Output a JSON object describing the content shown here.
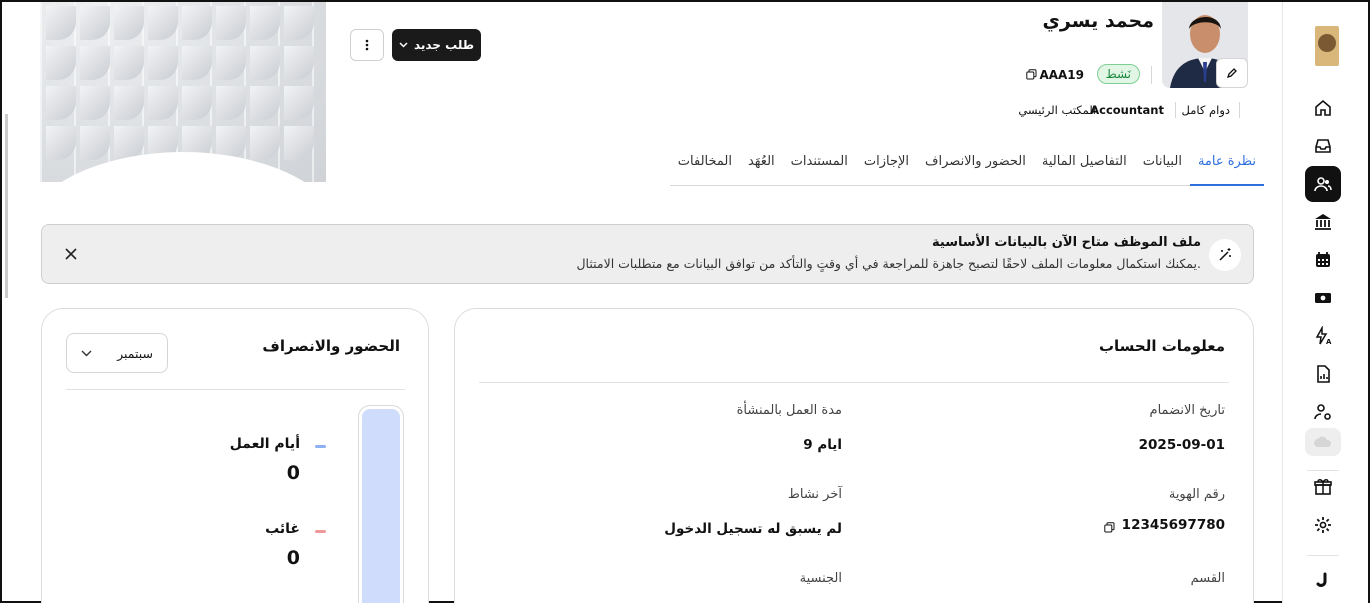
{
  "employee": {
    "name": "محمد يسري",
    "status": "نَشط",
    "code": "AAA19",
    "employment_type": "دوام كامل",
    "job_title": "Accountant",
    "branch": "المكتب الرئيسي"
  },
  "actions": {
    "new_request": "طلب جديد"
  },
  "tabs": [
    "نظرة عامة",
    "البيانات",
    "التفاصيل المالية",
    "الحضور والانصراف",
    "الإجازات",
    "المستندات",
    "العُهَد",
    "المخالفات"
  ],
  "alert": {
    "title": "ملف الموظف متاح الآن بالبيانات الأساسية",
    "body": "يمكنك استكمال معلومات الملف لاحقًا لتصبح جاهزة للمراجعة في أي وقتٍ والتأكد من توافق البيانات مع متطلبات الامتثال."
  },
  "account": {
    "title": "معلومات الحساب",
    "join_date_label": "تاريخ الانضمام",
    "join_date": "2025-09-01",
    "tenure_label": "مدة العمل بالمنشأة",
    "tenure": "9 ايام",
    "id_label": "رقم الهوية",
    "id_number": "12345697780",
    "last_activity_label": "آخر نشاط",
    "last_activity": "لم يسبق له تسجيل الدخول",
    "department_label": "القسم",
    "nationality_label": "الجنسية"
  },
  "attendance": {
    "title": "الحضور والانصراف",
    "month": "سبتمبر",
    "work_days_label": "أيام العمل",
    "work_days": "0",
    "absent_label": "غائب",
    "absent": "0",
    "colors": {
      "work": "#8fb0f3",
      "absent": "#ef9a9a",
      "bar": "#cfdcfb"
    }
  },
  "sidebar_icons": [
    "logo",
    "home-icon",
    "inbox-icon",
    "users-icon",
    "bank-icon",
    "calendar-icon",
    "money-icon",
    "automation-icon",
    "report-icon",
    "user-settings-icon",
    "cloud-icon",
    "gift-icon",
    "settings-icon",
    "brand-mark-icon"
  ],
  "colors": {
    "accent": "#2e6fe0",
    "dark": "#1a1a1a",
    "active_badge": "#1c8a3d"
  }
}
